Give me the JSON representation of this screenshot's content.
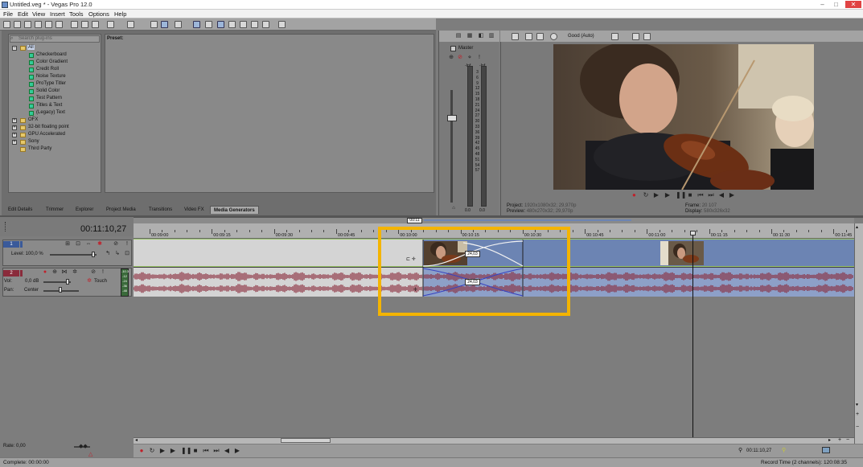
{
  "window": {
    "title": "Untitled.veg * - Vegas Pro 12.0"
  },
  "menu": [
    "File",
    "Edit",
    "View",
    "Insert",
    "Tools",
    "Options",
    "Help"
  ],
  "explorer": {
    "search_placeholder": "Search plug-ins",
    "preset_label": "Preset:",
    "tree": {
      "root": "All",
      "children": [
        "Checkerboard",
        "Color Gradient",
        "Credit Roll",
        "Noise Texture",
        "ProType Titler",
        "Solid Color",
        "Test Pattern",
        "Titles & Text",
        "(Legacy) Text"
      ],
      "groups": [
        "OFX",
        "32-bit floating point",
        "GPU Accelerated",
        "Sony",
        "Third Party"
      ]
    },
    "tabs": [
      "Edit Details",
      "Trimmer",
      "Explorer",
      "Project Media",
      "Transitions",
      "Video FX",
      "Media Generators"
    ],
    "active_tab": "Media Generators"
  },
  "mixer": {
    "label": "Master",
    "scale_top": [
      "-Inf.",
      "-Inf."
    ],
    "scale": [
      "3",
      "6",
      "9",
      "12",
      "15",
      "18",
      "21",
      "24",
      "27",
      "30",
      "33",
      "36",
      "39",
      "42",
      "45",
      "48",
      "51",
      "54",
      "57"
    ],
    "readout": [
      "0.0",
      "0.0"
    ]
  },
  "preview": {
    "quality": "Good (Auto)",
    "project_label": "Project:",
    "project_value": "1920x1080x32; 29,970p",
    "preview_label": "Preview:",
    "preview_value": "480x270x32; 29,970p",
    "frame_label": "Frame:",
    "frame_value": "20 107",
    "display_label": "Display:",
    "display_value": "580x326x32"
  },
  "timeline": {
    "timecode": "00:11:10,27",
    "loop_marker": "00:11",
    "ruler": [
      "00:09:00",
      "00:09:15",
      "00:09:30",
      "00:09:45",
      "00:10:00",
      "00:10:15",
      "00:10:30",
      "00:10:45",
      "00:11:00",
      "00:11:15",
      "00:11:30",
      "00:11:45"
    ],
    "video_track": {
      "number": "1",
      "level": "Level: 100,0 %"
    },
    "audio_track": {
      "number": "2",
      "vol": "Vol:",
      "vol_value": "0,0 dB",
      "pan": "Pan:",
      "pan_value": "Center",
      "automation": "Touch",
      "meter": [
        "-10.3",
        "-12",
        "-24",
        "-36",
        "-48"
      ]
    },
    "crossfade_label": "24,03",
    "rate": "Rate: 0,00"
  },
  "transport": {
    "cursor_time": "00:11:10,27"
  },
  "status": {
    "left": "Complete: 00:00:00",
    "right": "Record Time (2 channels): 120:08:35"
  },
  "colors": {
    "highlight": "#f4b400",
    "selection": "#6c84b3",
    "waveform": "#8a2b3b",
    "record": "#c0202a"
  }
}
